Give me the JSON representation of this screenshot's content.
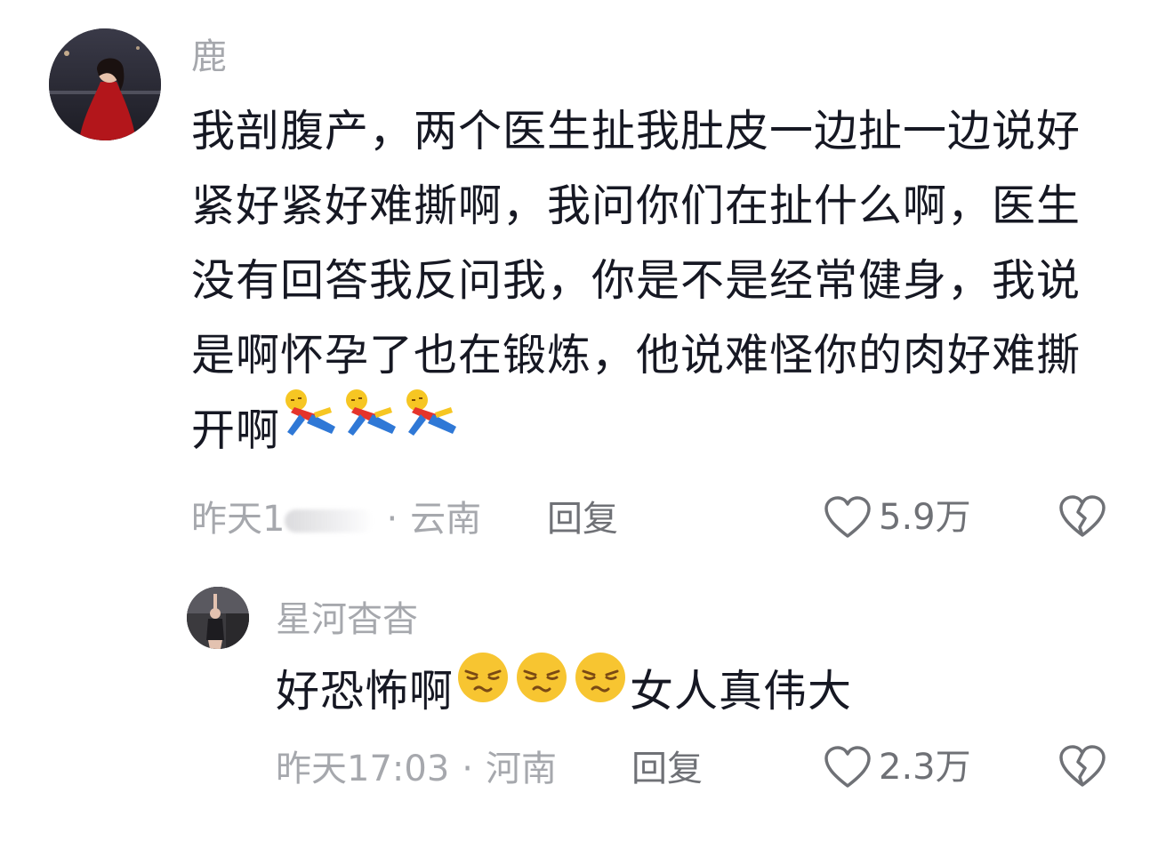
{
  "comments": [
    {
      "author": "鹿",
      "text_lines": [
        "我剖腹产，两个医生扯我肚皮一边扯一边说好",
        "紧好紧好难撕啊，我问你们在扯什么啊，医生",
        "没有回答我反问我，你是不是经常健身，我说",
        "是啊怀孕了也在锻炼，他说难怪你的肉好难撕",
        "开啊"
      ],
      "emojis": [
        "lying-down-emoji",
        "lying-down-emoji",
        "lying-down-emoji"
      ],
      "time_prefix": "昨天1",
      "separator": "·",
      "location": "云南",
      "reply_label": "回复",
      "like_count": "5.9万"
    },
    {
      "author": "星河杳杳",
      "text_before_emoji": "好恐怖啊",
      "emojis": [
        "smirk-emoji",
        "smirk-emoji",
        "smirk-emoji"
      ],
      "text_after_emoji": "女人真伟大",
      "time": "昨天17:03",
      "separator": "·",
      "location": "河南",
      "reply_label": "回复",
      "like_count": "2.3万"
    }
  ],
  "colors": {
    "primary_text": "#161823",
    "secondary_text": "#a6a8ad",
    "action_text": "#6f7176"
  },
  "icons": {
    "like": "heart-outline-icon",
    "dislike": "broken-heart-icon"
  }
}
